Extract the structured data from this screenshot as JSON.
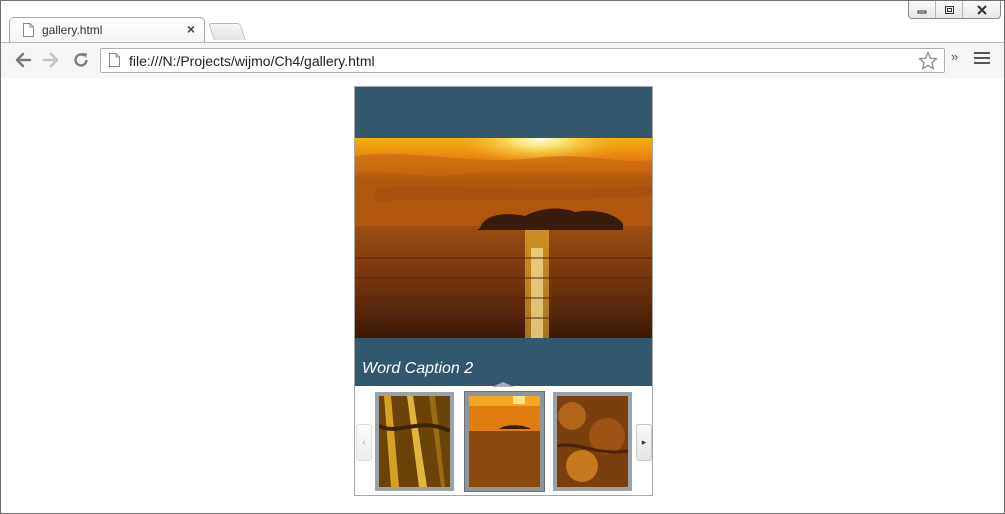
{
  "browser": {
    "tab": {
      "title": "gallery.html",
      "close_glyph": "×"
    },
    "window_controls": [
      "minimize-icon",
      "restore-icon",
      "close-icon"
    ],
    "toolbar": {
      "back_icon": "back-arrow-icon",
      "forward_icon": "forward-arrow-icon",
      "reload_icon": "reload-icon",
      "url": "file:///N:/Projects/wijmo/Ch4/gallery.html",
      "bookmark_icon": "star-icon",
      "overflow_glyph": "»",
      "menu_icon": "hamburger-menu-icon"
    }
  },
  "gallery": {
    "caption": "Word Caption 2",
    "main_image": "sunset-over-water",
    "selected_index": 1,
    "thumbnails": [
      {
        "name": "thumbnail-1",
        "image": "golden-reeds"
      },
      {
        "name": "thumbnail-2",
        "image": "sunset-over-water"
      },
      {
        "name": "thumbnail-3",
        "image": "autumn-foliage"
      }
    ],
    "prev_glyph": "‹",
    "next_glyph": "▸",
    "colors": {
      "header_bg": "#33586e",
      "caption_text": "#ffffff",
      "thumb_frame": "#9aa3a9"
    }
  }
}
